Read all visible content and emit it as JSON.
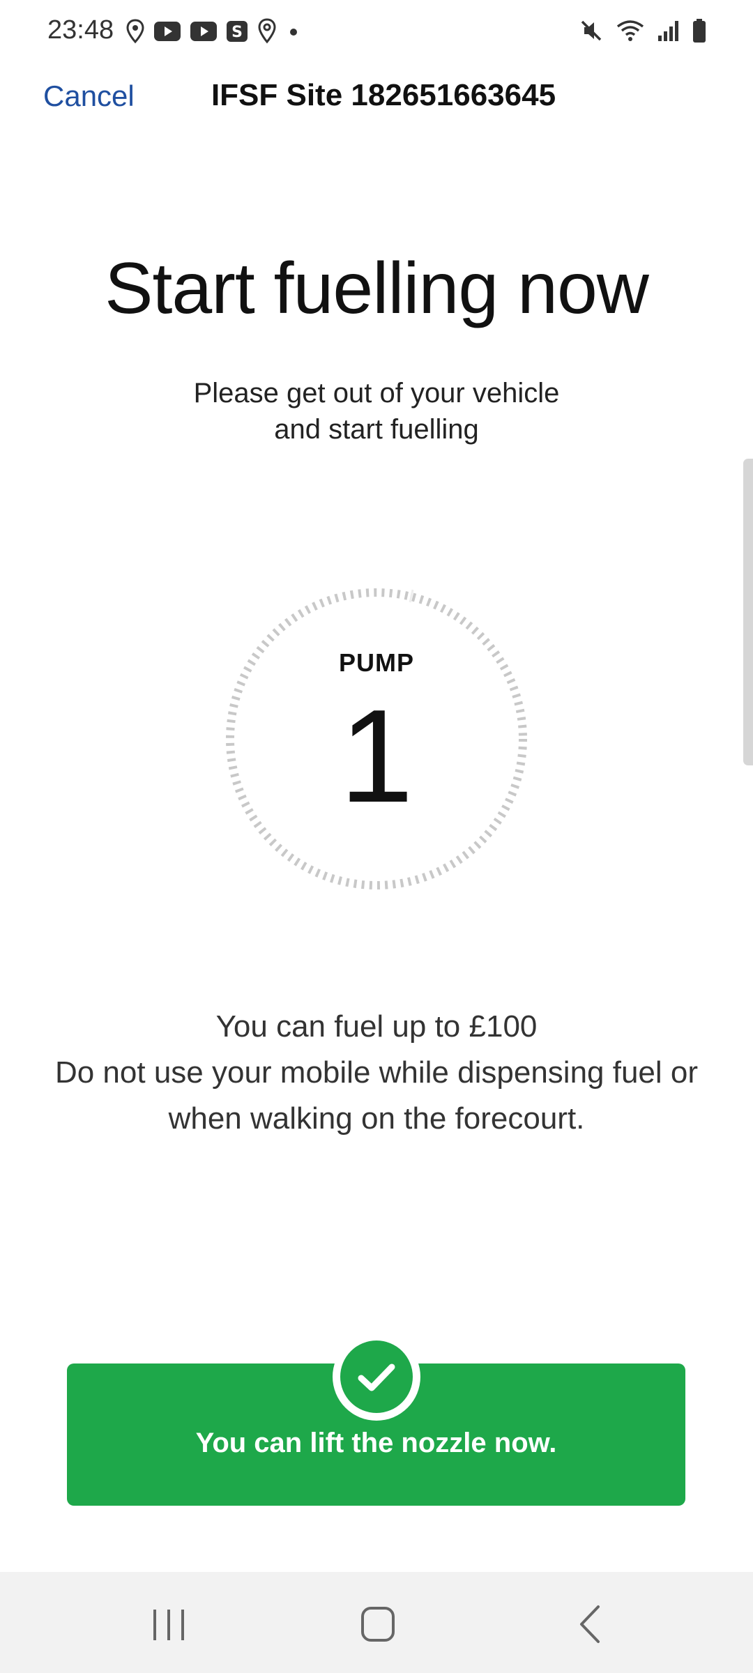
{
  "status_bar": {
    "time": "23:48",
    "left_icons": [
      "location-icon",
      "youtube-icon",
      "youtube-icon",
      "s-app-icon",
      "maps-icon",
      "dot-icon"
    ],
    "right_icons": [
      "mute-icon",
      "wifi-icon",
      "signal-icon",
      "battery-icon"
    ]
  },
  "header": {
    "cancel_label": "Cancel",
    "site_title": "IFSF Site 182651663645"
  },
  "main": {
    "title": "Start fuelling now",
    "subtitle_line1": "Please get out of your vehicle",
    "subtitle_line2": "and start fuelling",
    "pump_label": "PUMP",
    "pump_number": "1",
    "info_line1": "You can fuel up to £100",
    "info_line2": "Do not use your mobile while dispensing fuel or",
    "info_line3": "when walking on the forecourt."
  },
  "banner": {
    "text": "You can lift the nozzle now.",
    "color": "#1ea84a"
  },
  "nav_bar": {
    "buttons": [
      "recents-icon",
      "home-icon",
      "back-icon"
    ]
  },
  "colors": {
    "accent": "#1f4fa0",
    "success": "#1ea84a",
    "dial": "#c8c8c8"
  }
}
